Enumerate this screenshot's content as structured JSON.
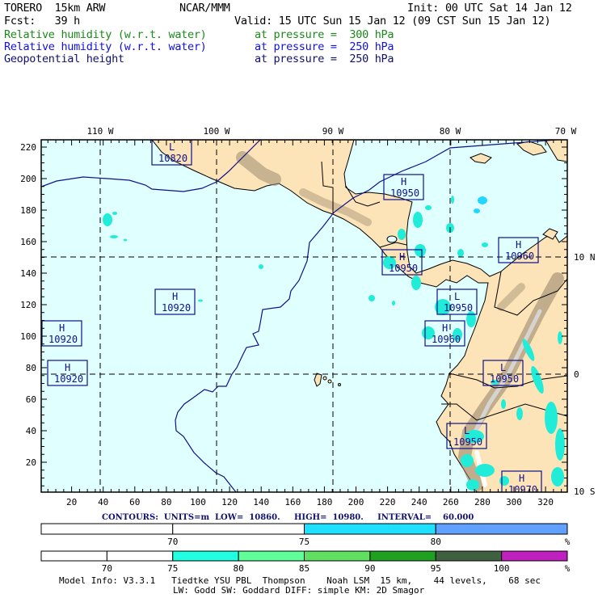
{
  "header": {
    "model": "TORERO  15km ARW",
    "org": "NCAR/MMM",
    "init": "Init: 00 UTC Sat 14 Jan 12",
    "fcst": "Fcst:   39 h",
    "valid": "Valid: 15 UTC Sun 15 Jan 12 (09 CST Sun 15 Jan 12)"
  },
  "fields": [
    {
      "name": "Relative humidity (w.r.t. water)",
      "level": "at pressure =  300 hPa",
      "color": "#1a8a1a"
    },
    {
      "name": "Relative humidity (w.r.t. water)",
      "level": "at pressure =  250 hPa",
      "color": "#1010e0"
    },
    {
      "name": "Geopotential height",
      "level": "at pressure =  250 hPa",
      "color": "#10106e"
    }
  ],
  "map": {
    "x_ticks": [
      20,
      40,
      60,
      80,
      100,
      120,
      140,
      160,
      180,
      200,
      220,
      240,
      260,
      280,
      300,
      320
    ],
    "y_ticks": [
      20,
      40,
      60,
      80,
      100,
      120,
      140,
      160,
      180,
      200,
      220
    ],
    "lon_labels": [
      "110 W",
      "100 W",
      "90 W",
      "80 W",
      "70 W"
    ],
    "lat_labels": [
      "10 N",
      "0",
      "10 S"
    ],
    "centers": [
      {
        "type": "L",
        "value": "10820"
      },
      {
        "type": "H",
        "value": "10920"
      },
      {
        "type": "H",
        "value": "10920"
      },
      {
        "type": "H",
        "value": "10920"
      },
      {
        "type": "H",
        "value": "10950"
      },
      {
        "type": "H",
        "value": "10950"
      },
      {
        "type": "H",
        "value": "10960"
      },
      {
        "type": "L",
        "value": "10950"
      },
      {
        "type": "H",
        "value": "10960"
      },
      {
        "type": "L",
        "value": "10950"
      },
      {
        "type": "L",
        "value": "10950"
      },
      {
        "type": "H",
        "value": "10970"
      }
    ]
  },
  "contours_info": "CONTOURS:  UNITS=m  LOW=  10860.     HIGH=  10980.     INTERVAL=    60.000",
  "colorbar_250": {
    "labels": [
      "70",
      "75",
      "80",
      "%"
    ],
    "colors": [
      "#ffffff",
      "#ffffff",
      "#20e0ff",
      "#60a0ff"
    ]
  },
  "colorbar_300": {
    "labels": [
      "70",
      "75",
      "80",
      "85",
      "90",
      "95",
      "100",
      "%"
    ],
    "colors": [
      "#ffffff",
      "#ffffff",
      "#20ffe0",
      "#60ff9a",
      "#60e060",
      "#20a020",
      "#406040",
      "#c020c0"
    ]
  },
  "model_info": {
    "line1": "Model Info: V3.3.1   Tiedtke YSU PBL  Thompson    Noah LSM  15 km,    44 levels,    68 sec",
    "line2": "LW: Godd SW: Goddard DIFF: simple KM: 2D Smagor"
  }
}
